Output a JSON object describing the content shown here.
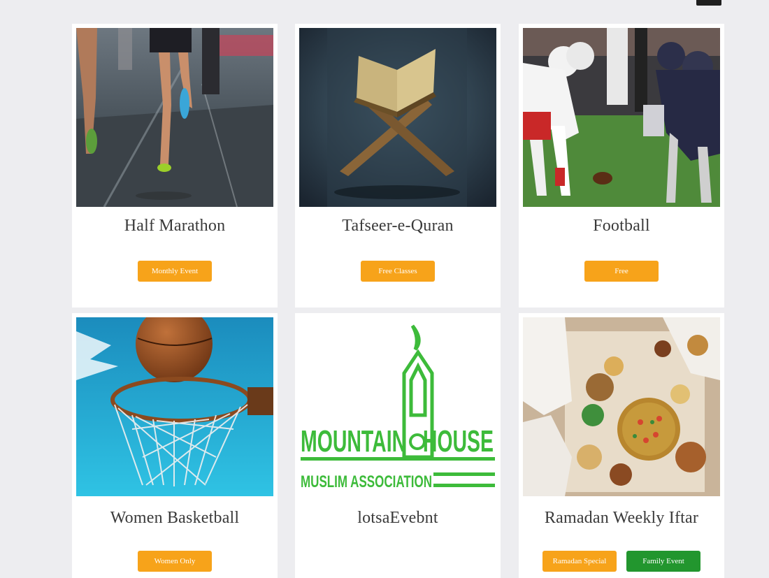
{
  "cards": [
    {
      "title": "Half Marathon",
      "badges": [
        "Monthly Event"
      ]
    },
    {
      "title": "Tafseer-e-Quran",
      "badges": [
        "Free Classes"
      ]
    },
    {
      "title": "Football",
      "badges": [
        "Free"
      ]
    },
    {
      "title": "Women Basketball",
      "badges": [
        "Women Only"
      ]
    },
    {
      "title": "lotsaEvebnt",
      "badges": []
    },
    {
      "title": "Ramadan Weekly Iftar",
      "badges": [
        "Ramadan Special",
        "Family Event"
      ]
    }
  ],
  "logo": {
    "line1": "MOUNTAIN",
    "line2": "HOUSE",
    "line3": "MUSLIM ASSOCIATION"
  },
  "colors": {
    "badge_orange": "#f7a31a",
    "badge_green": "#22962e",
    "logo_green": "#3dbb3a"
  }
}
